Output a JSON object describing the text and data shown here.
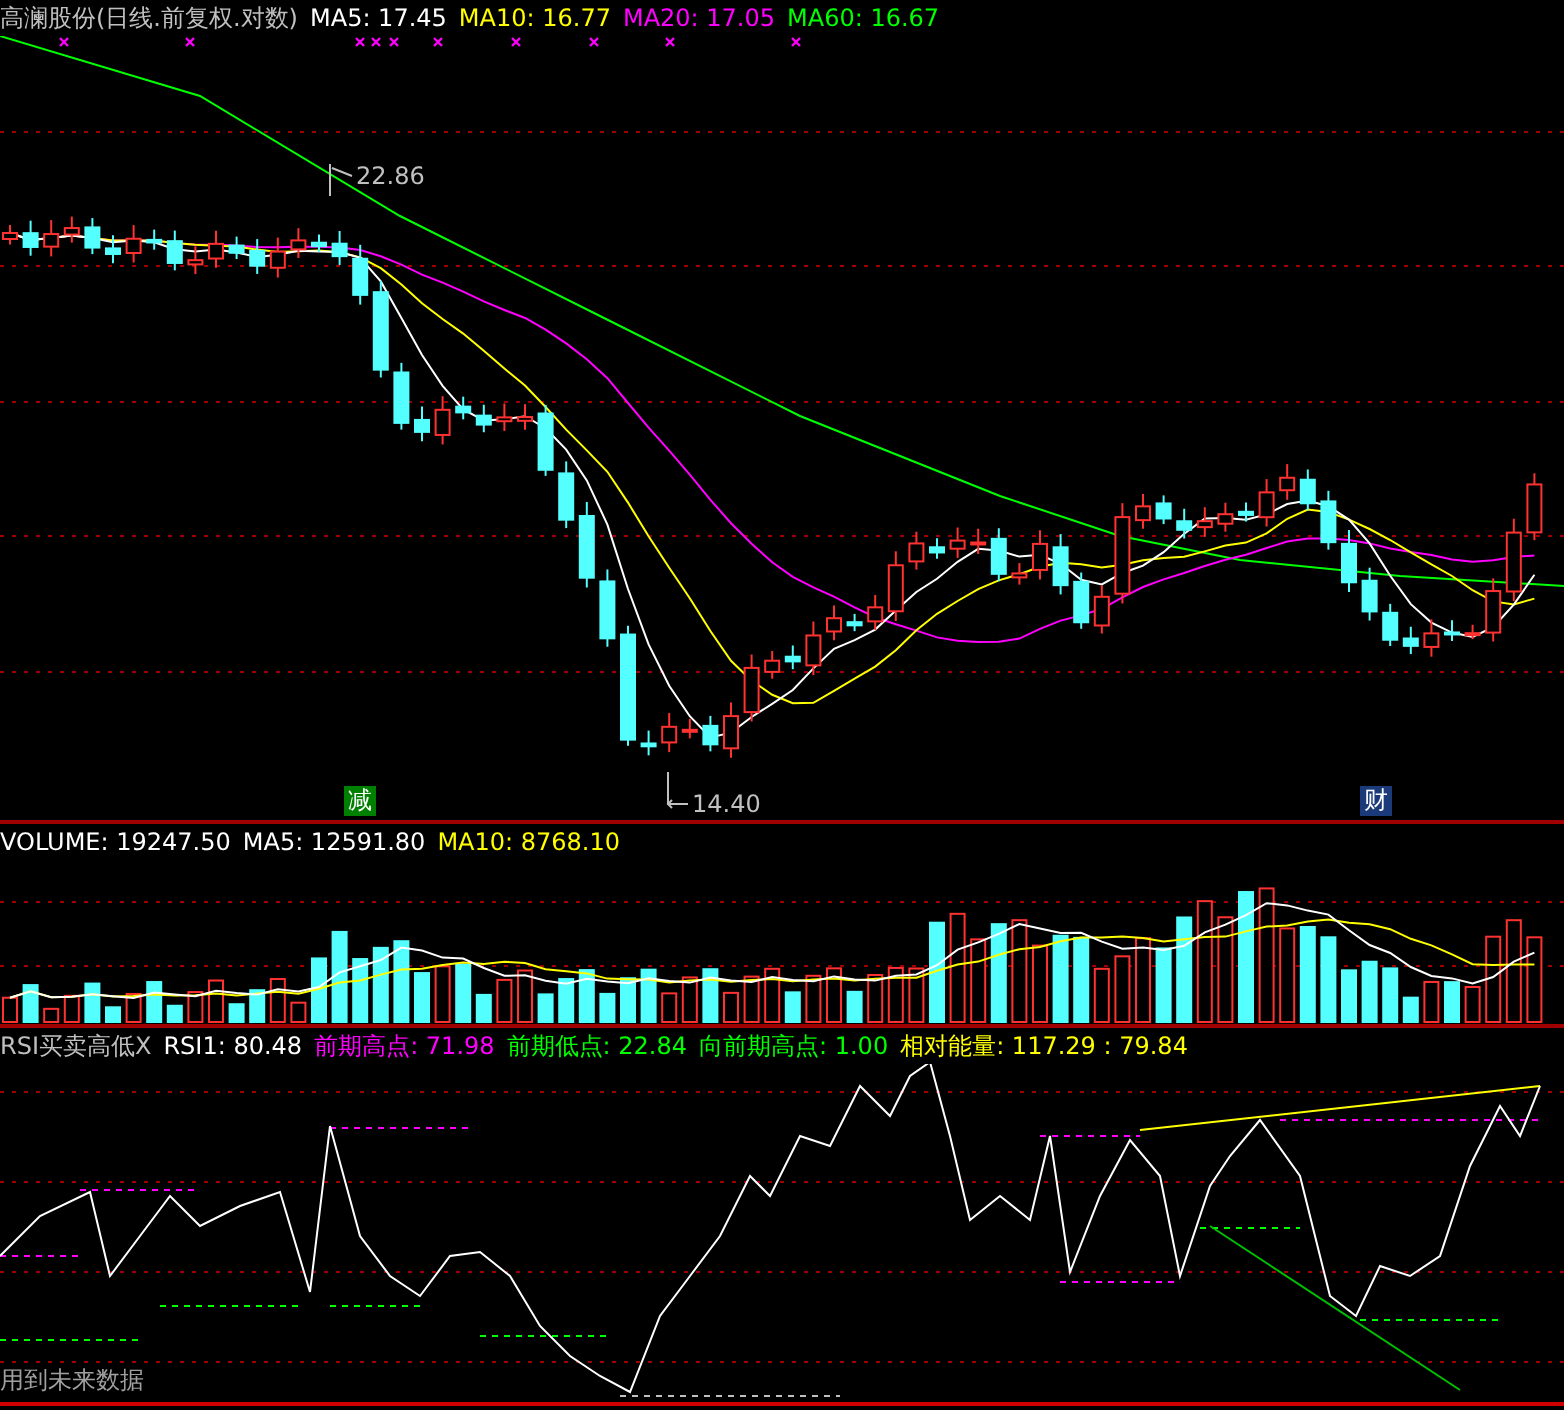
{
  "main_chart": {
    "legend": [
      {
        "label": "高澜股份(日线.前复权.对数)",
        "color": "#c0c0c0"
      },
      {
        "label": "MA5: 17.45",
        "color": "#ffffff"
      },
      {
        "label": "MA10: 16.77",
        "color": "#ffff00"
      },
      {
        "label": "MA20: 17.05",
        "color": "#ff00ff"
      },
      {
        "label": "MA60: 16.67",
        "color": "#00ff00"
      }
    ],
    "price_labels": [
      {
        "text": "22.86"
      },
      {
        "text": "14.40"
      }
    ],
    "badges": [
      {
        "text": "减",
        "color": "#008000"
      },
      {
        "text": "财",
        "color": "#1a3a7a"
      }
    ]
  },
  "volume_chart": {
    "legend": [
      {
        "label": "VOLUME: 19247.50",
        "color": "#ffffff"
      },
      {
        "label": "MA5: 12591.80",
        "color": "#ffffff"
      },
      {
        "label": "MA10: 8768.10",
        "color": "#ffff00"
      }
    ]
  },
  "rsi_chart": {
    "legend": [
      {
        "label": "RSI买卖高低X",
        "color": "#c0c0c0"
      },
      {
        "label": "RSI1: 80.48",
        "color": "#ffffff"
      },
      {
        "label": "前期高点: 71.98",
        "color": "#ff00ff"
      },
      {
        "label": "前期低点: 22.84",
        "color": "#00ff00"
      },
      {
        "label": "向前期高点: 1.00",
        "color": "#00ff00"
      },
      {
        "label": "相对能量: 117.29 : 79.84",
        "color": "#ffff00"
      }
    ],
    "footer": "用到未来数据"
  }
}
